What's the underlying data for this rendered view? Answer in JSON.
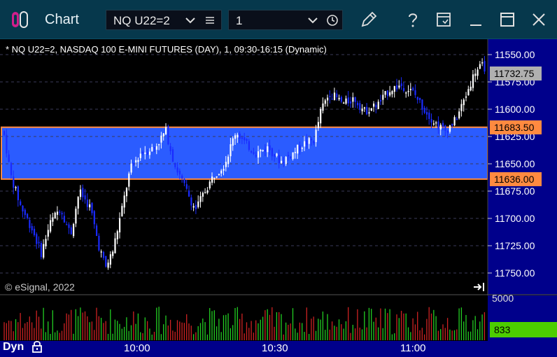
{
  "window": {
    "title": "Chart",
    "symbol": "NQ U22=2",
    "interval": "1"
  },
  "chart_header": "* NQ U22=2, NASDAQ 100 E-MINI FUTURES (DAY), 1, 09:30-16:15 (Dynamic)",
  "copyright": "© eSignal, 2022",
  "dyn_label": "Dyn",
  "price_axis": {
    "ticks": [
      "11750.00",
      "11725.00",
      "11700.00",
      "11675.00",
      "11650.00",
      "11625.00",
      "11600.00",
      "11575.00",
      "11550.00"
    ],
    "last_price": "11732.75",
    "zone_top": "11683.50",
    "zone_bottom": "11636.00"
  },
  "volume_axis": {
    "tick": "5000",
    "current": "833"
  },
  "time_axis": [
    "10:00",
    "10:30",
    "11:00"
  ],
  "colors": {
    "titlebar": "#06384c",
    "zone_fill": "#2b5cff",
    "zone_border": "#ff8a40",
    "axis_bg": "#00008b",
    "up_candle": "#ffffff",
    "down_candle": "#1a2bff",
    "volume_up": "#22cc22",
    "volume_down": "#cc2222",
    "volume_badge": "#4ccd00",
    "last_badge": "#b0b0b0"
  },
  "chart_data": {
    "type": "candlestick",
    "title": "* NQ U22=2, NASDAQ 100 E-MINI FUTURES (DAY), 1, 09:30-16:15 (Dynamic)",
    "x_labels": [
      "10:00",
      "10:30",
      "11:00"
    ],
    "ylim": [
      11540,
      11765
    ],
    "y_ticks": [
      11550,
      11575,
      11600,
      11625,
      11650,
      11675,
      11700,
      11725,
      11750
    ],
    "highlight_zone": [
      11636.0,
      11683.5
    ],
    "last": 11732.75,
    "volume_max_tick": 5000,
    "volume_last": 833
  }
}
